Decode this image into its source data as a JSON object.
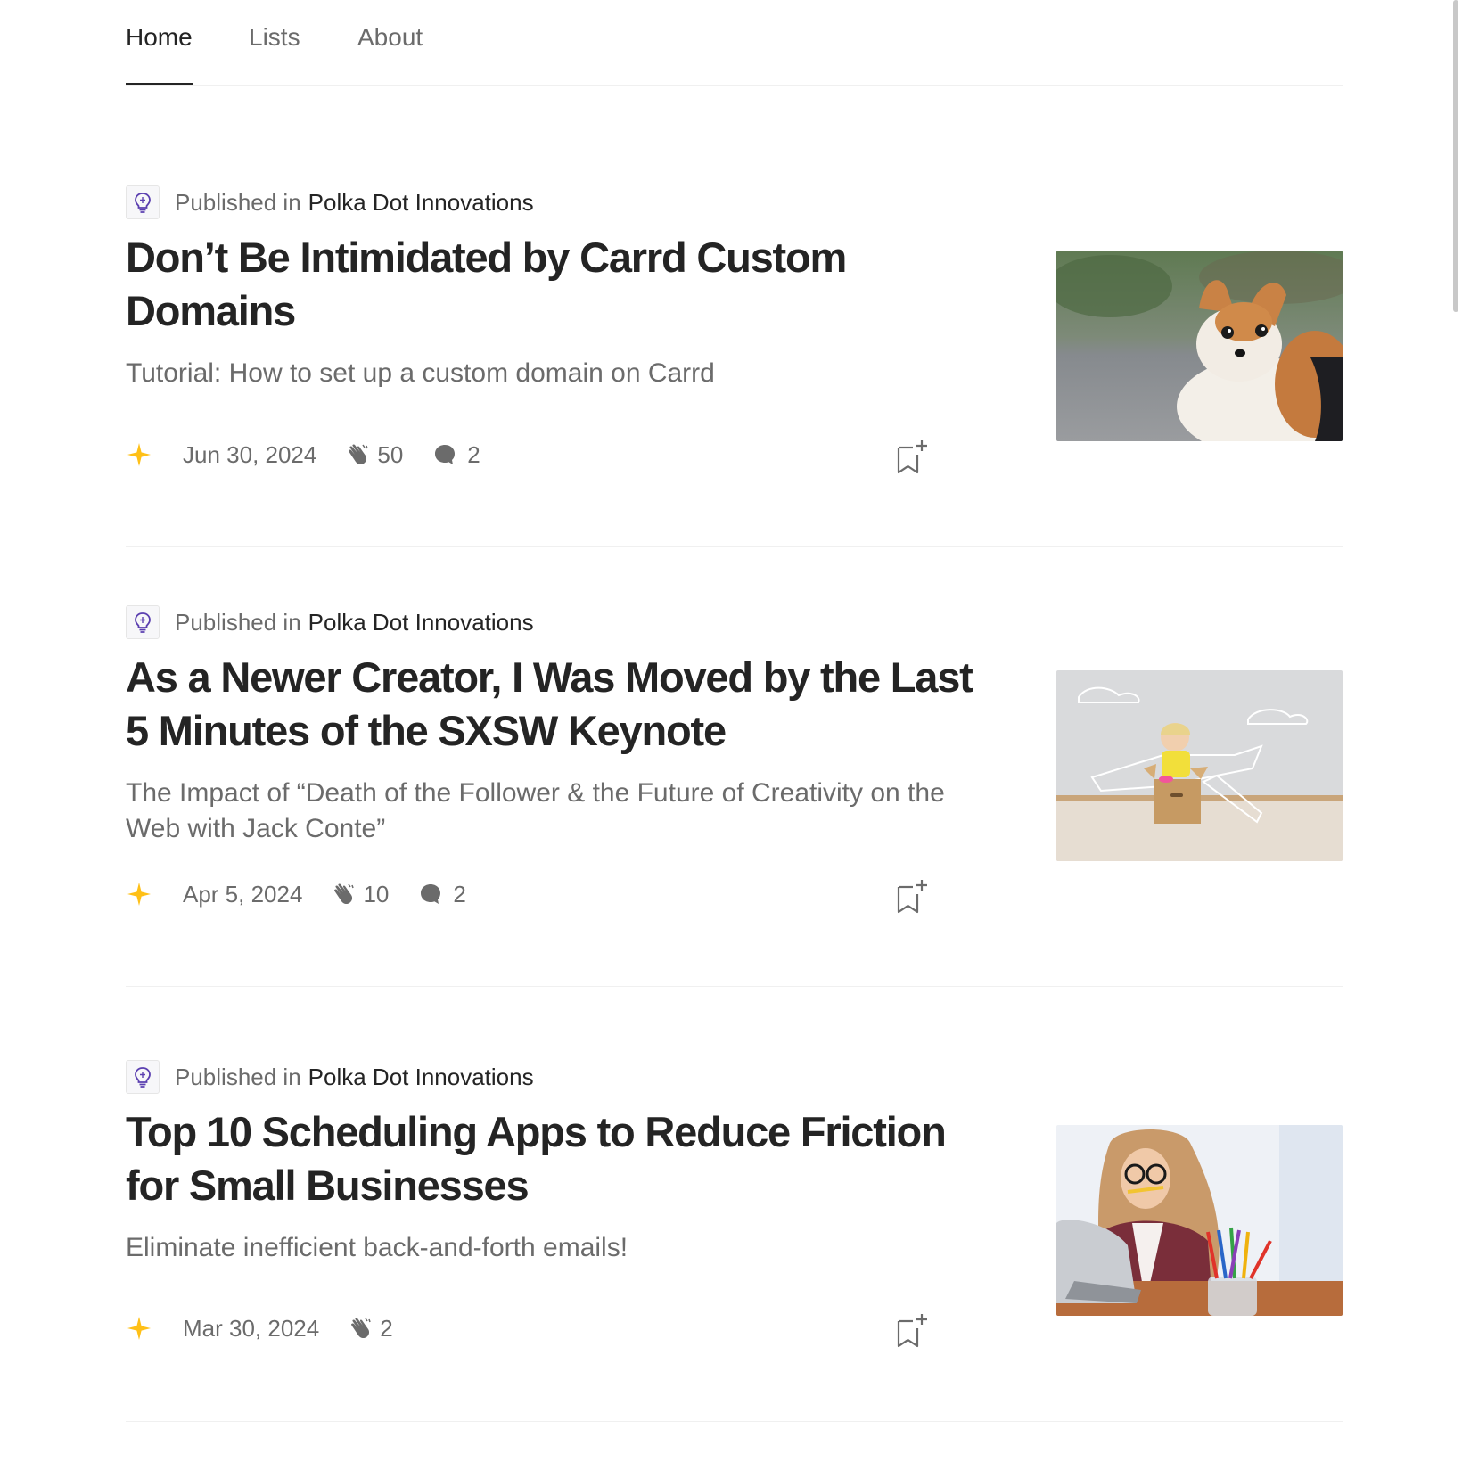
{
  "tabs": [
    {
      "label": "Home",
      "active": true
    },
    {
      "label": "Lists",
      "active": false
    },
    {
      "label": "About",
      "active": false
    }
  ],
  "articles": [
    {
      "published_in_label": "Published in",
      "publication": "Polka Dot Innovations",
      "title": "Don’t Be Intimidated by Carrd Custom Domains",
      "subtitle": "Tutorial: How to set up a custom domain on Carrd",
      "date": "Jun 30, 2024",
      "claps": "50",
      "responses": "2",
      "image": "dog-photo"
    },
    {
      "published_in_label": "Published in",
      "publication": "Polka Dot Innovations",
      "title": "As a Newer Creator, I Was Moved by the Last 5 Minutes of the SXSW Keynote",
      "subtitle": "The Impact of “Death of the Follower & the Future of Creativity on the Web with Jack Conte”",
      "date": "Apr 5, 2024",
      "claps": "10",
      "responses": "2",
      "image": "child-in-box-photo"
    },
    {
      "published_in_label": "Published in",
      "publication": "Polka Dot Innovations",
      "title": "Top 10 Scheduling Apps to Reduce Friction for Small Businesses",
      "subtitle": "Eliminate inefficient back-and-forth emails!",
      "date": "Mar 30, 2024",
      "claps": "2",
      "responses": null,
      "image": "woman-with-laptop-photo"
    }
  ],
  "colors": {
    "text": "#242424",
    "muted": "#6b6b6b",
    "star": "#FFC017",
    "divider": "#f0f0f0",
    "logo_purple": "#5b3fb0"
  }
}
